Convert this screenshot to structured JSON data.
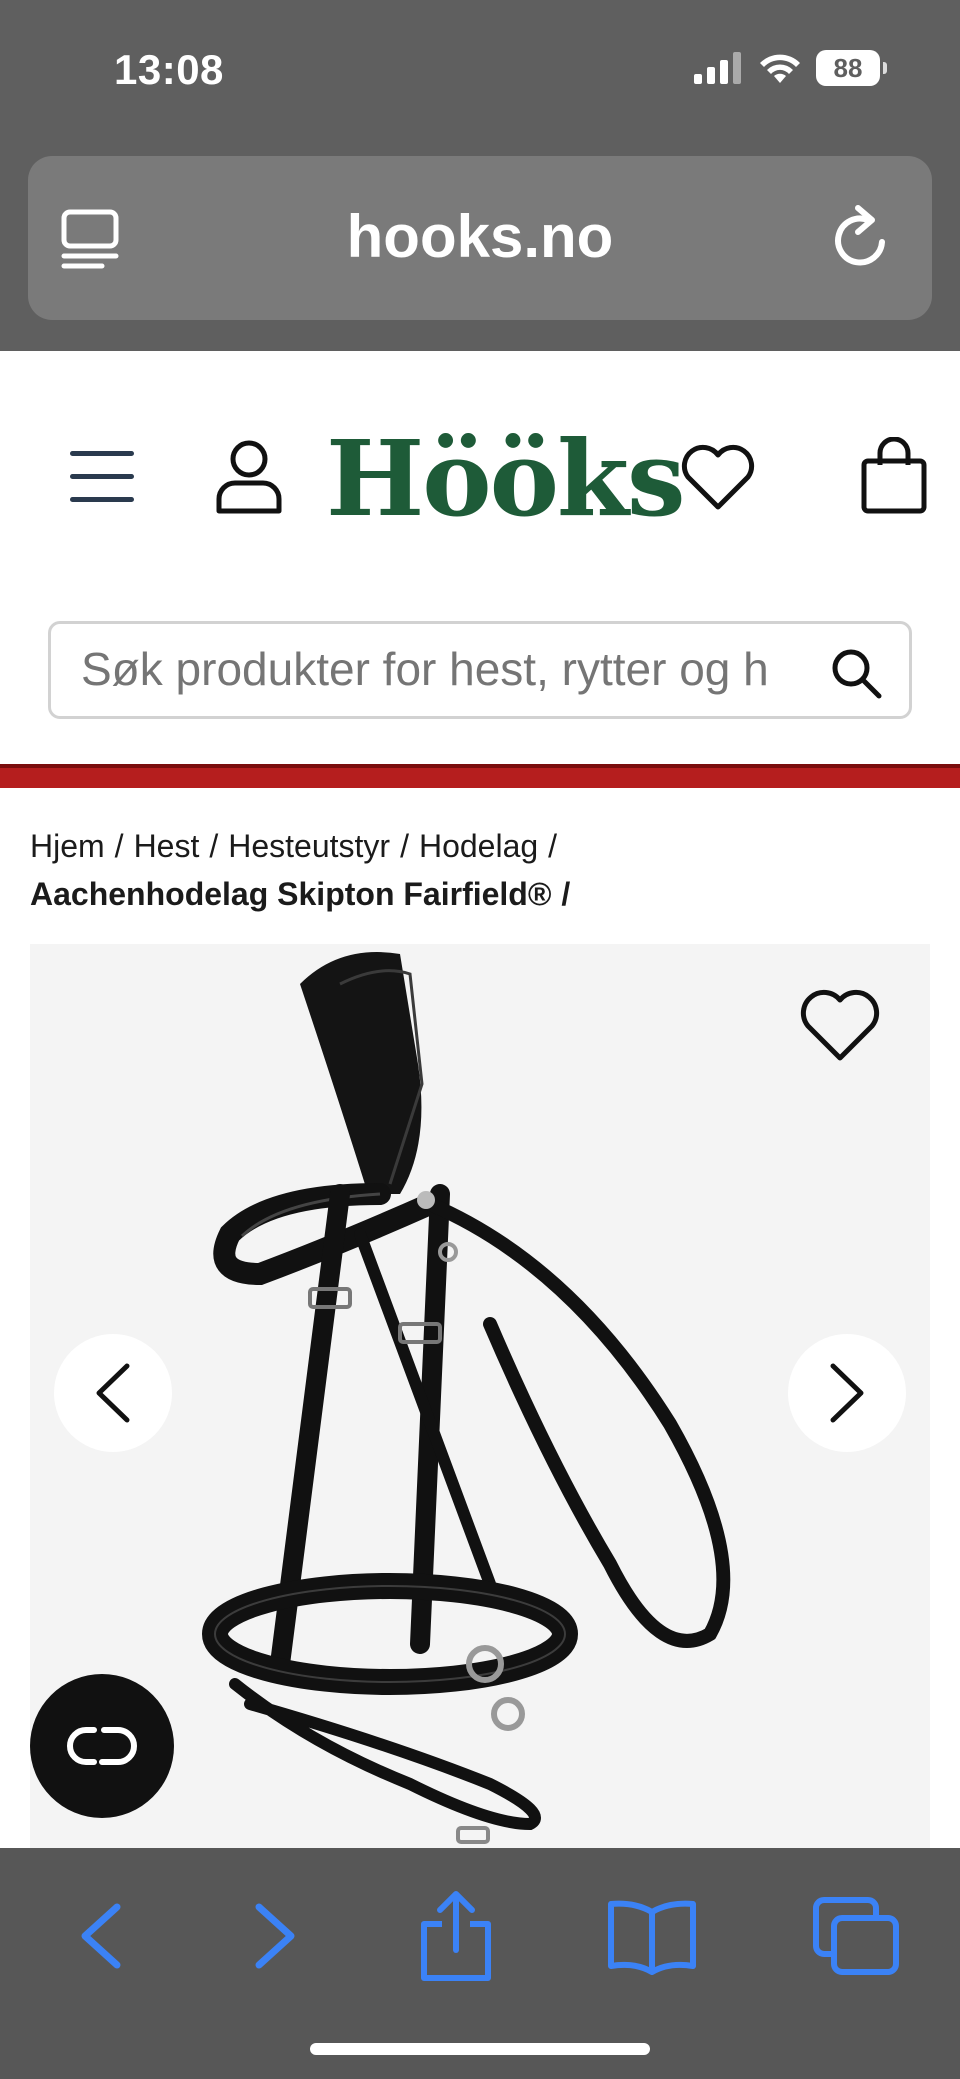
{
  "status_bar": {
    "time": "13:08",
    "battery": "88"
  },
  "browser": {
    "url": "hooks.no",
    "left_icon": "tabs-overview-icon",
    "right_icon": "reload-icon"
  },
  "header": {
    "logo_text": "Hööks",
    "logo_color": "#1e5b38",
    "menu_icon": "hamburger-menu-icon",
    "account_icon": "user-icon",
    "wishlist_icon": "heart-icon",
    "cart_icon": "shopping-bag-icon"
  },
  "search": {
    "placeholder": "Søk produkter for hest, rytter og hund"
  },
  "accent_color": "#b51e1e",
  "breadcrumb": {
    "items": [
      "Hjem",
      "Hest",
      "Hesteutstyr",
      "Hodelag"
    ],
    "current": "Aachenhodelag Skipton Fairfield®"
  },
  "product": {
    "image_alt": "Aachenhodelag Skipton Fairfield",
    "favorite_icon": "heart-outline-icon",
    "prev_icon": "chevron-left-icon",
    "next_icon": "chevron-right-icon"
  },
  "chat": {
    "icon": "chat-widget-icon"
  },
  "toolbar": {
    "icons": [
      "back-icon",
      "forward-icon",
      "share-icon",
      "bookmarks-icon",
      "tabs-icon"
    ],
    "accent": "#3b82f6"
  }
}
